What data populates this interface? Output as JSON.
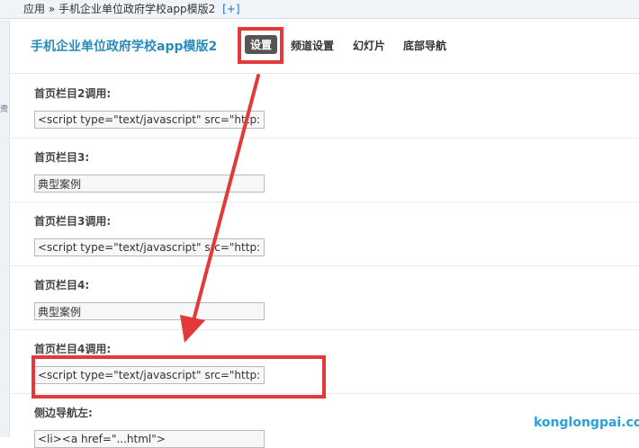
{
  "breadcrumb": {
    "root": "应用",
    "sep": "»",
    "current": "手机企业单位政府学校app模版2",
    "plus": "[+]"
  },
  "header": {
    "title": "手机企业单位政府学校app模版2",
    "tabs": [
      "设置",
      "频道设置",
      "幻灯片",
      "底部导航"
    ]
  },
  "left_glyph": "资",
  "fields": [
    {
      "label": "首页栏目2调用:",
      "value": "<script type=\"text/javascript\" src=\"http:"
    },
    {
      "label": "首页栏目3:",
      "value": "典型案例"
    },
    {
      "label": "首页栏目3调用:",
      "value": "<script type=\"text/javascript\" src=\"http:"
    },
    {
      "label": "首页栏目4:",
      "value": "典型案例"
    },
    {
      "label": "首页栏目4调用:",
      "value": "<script type=\"text/javascript\" src=\"http:"
    },
    {
      "label": "侧边导航左:",
      "value": "<li><a href=\"...html\">"
    }
  ],
  "watermark": "konglongpai.com",
  "colors": {
    "title": "#2a8bb9",
    "highlight": "#e23a3a",
    "active_tab": "#555555"
  }
}
